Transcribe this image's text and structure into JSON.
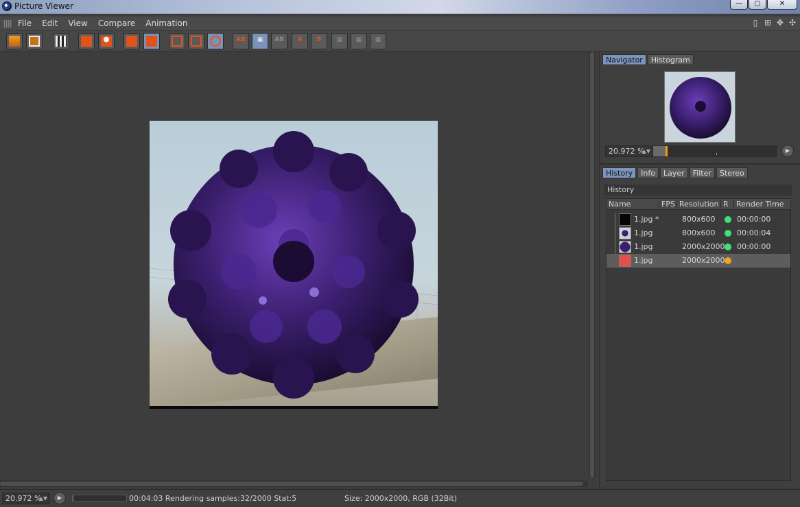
{
  "window": {
    "title": "Picture Viewer",
    "minimize": "—",
    "maximize": "▢",
    "close": "✕"
  },
  "menu": [
    "File",
    "Edit",
    "View",
    "Compare",
    "Animation"
  ],
  "right_panel": {
    "top_tabs": [
      "Navigator",
      "Histogram"
    ],
    "zoom_value": "20.972 %",
    "zoom_fraction": 0.1,
    "bottom_tabs": [
      "History",
      "Info",
      "Layer",
      "Filter",
      "Stereo"
    ],
    "history_label": "History",
    "columns": [
      "Name",
      "FPS",
      "Resolution",
      "R",
      "Render Time"
    ],
    "rows": [
      {
        "name": "1.jpg *",
        "fps": "",
        "resolution": "800x600",
        "status_color": "#3fe07a",
        "render_time": "00:00:00",
        "thumb": "black"
      },
      {
        "name": "1.jpg",
        "fps": "",
        "resolution": "800x600",
        "status_color": "#3fe07a",
        "render_time": "00:00:04",
        "thumb": "sphere-small"
      },
      {
        "name": "1.jpg",
        "fps": "",
        "resolution": "2000x2000",
        "status_color": "#3fe07a",
        "render_time": "00:00:00",
        "thumb": "sphere"
      },
      {
        "name": "1.jpg",
        "fps": "",
        "resolution": "2000x2000",
        "status_color": "#f2a21d",
        "render_time": "",
        "thumb": "rendering"
      }
    ]
  },
  "status": {
    "zoom": "20.972 %",
    "progress_fraction": 0.016,
    "render_info": "00:04:03 Rendering samples:32/2000 Stat:5",
    "size_info": "Size: 2000x2000, RGB (32Bit)"
  },
  "colors": {
    "accent_tab": "#7c95bc",
    "ok": "#3fe07a",
    "busy": "#f2a21d",
    "sphere": "#3b1f6e"
  }
}
